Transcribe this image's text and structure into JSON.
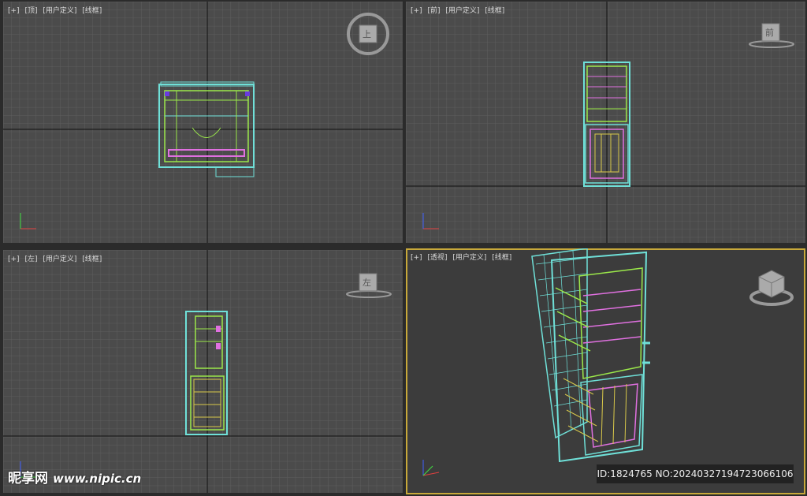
{
  "viewports": {
    "top": {
      "plus": "[+]",
      "view": "[顶]",
      "mode": "[用户定义]",
      "shading": "[线框]",
      "cube_label": "上"
    },
    "front": {
      "plus": "[+]",
      "view": "[前]",
      "mode": "[用户定义]",
      "shading": "[线框]",
      "cube_label": "前"
    },
    "left": {
      "plus": "[+]",
      "view": "[左]",
      "mode": "[用户定义]",
      "shading": "[线框]",
      "cube_label": "左"
    },
    "persp": {
      "plus": "[+]",
      "view": "[透视]",
      "mode": "[用户定义]",
      "shading": "[线框]"
    }
  },
  "watermark": {
    "brand": "昵享网",
    "url": "www.nipic.cn"
  },
  "image_id": "ID:1824765 NO:20240327194723066106",
  "colors": {
    "viewport_bg": "#4b4b4b",
    "grid": "#5e5e5e",
    "active_border": "#c8a93a",
    "wire_cyan": "#6fe0d8",
    "wire_green": "#9be84a",
    "wire_magenta": "#e070e0",
    "wire_yellow": "#d8c84a"
  }
}
